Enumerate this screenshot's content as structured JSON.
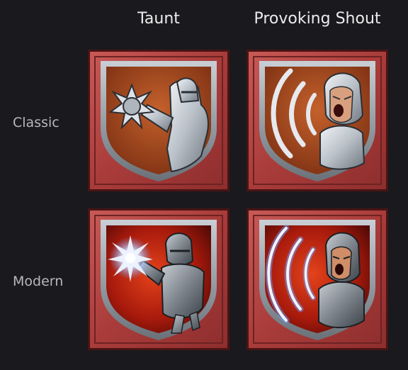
{
  "columns": [
    {
      "label": "Taunt"
    },
    {
      "label": "Provoking Shout"
    }
  ],
  "rows": [
    {
      "label": "Classic"
    },
    {
      "label": "Modern"
    }
  ],
  "icons": [
    {
      "row": "Classic",
      "ability": "Taunt",
      "icon": "knight-punch-icon"
    },
    {
      "row": "Classic",
      "ability": "Provoking Shout",
      "icon": "knight-shout-icon"
    },
    {
      "row": "Modern",
      "ability": "Taunt",
      "icon": "knight-taunt-energy-icon"
    },
    {
      "row": "Modern",
      "ability": "Provoking Shout",
      "icon": "knight-shout-energy-icon"
    }
  ],
  "colors": {
    "background": "#1a191e",
    "frame": "#b54848",
    "frame_dark": "#5e1c1c",
    "shield_rim": "#9aa2aa",
    "classic_field": "#a54a22",
    "modern_field": "#c22a10",
    "energy": "#cfe2ff"
  }
}
